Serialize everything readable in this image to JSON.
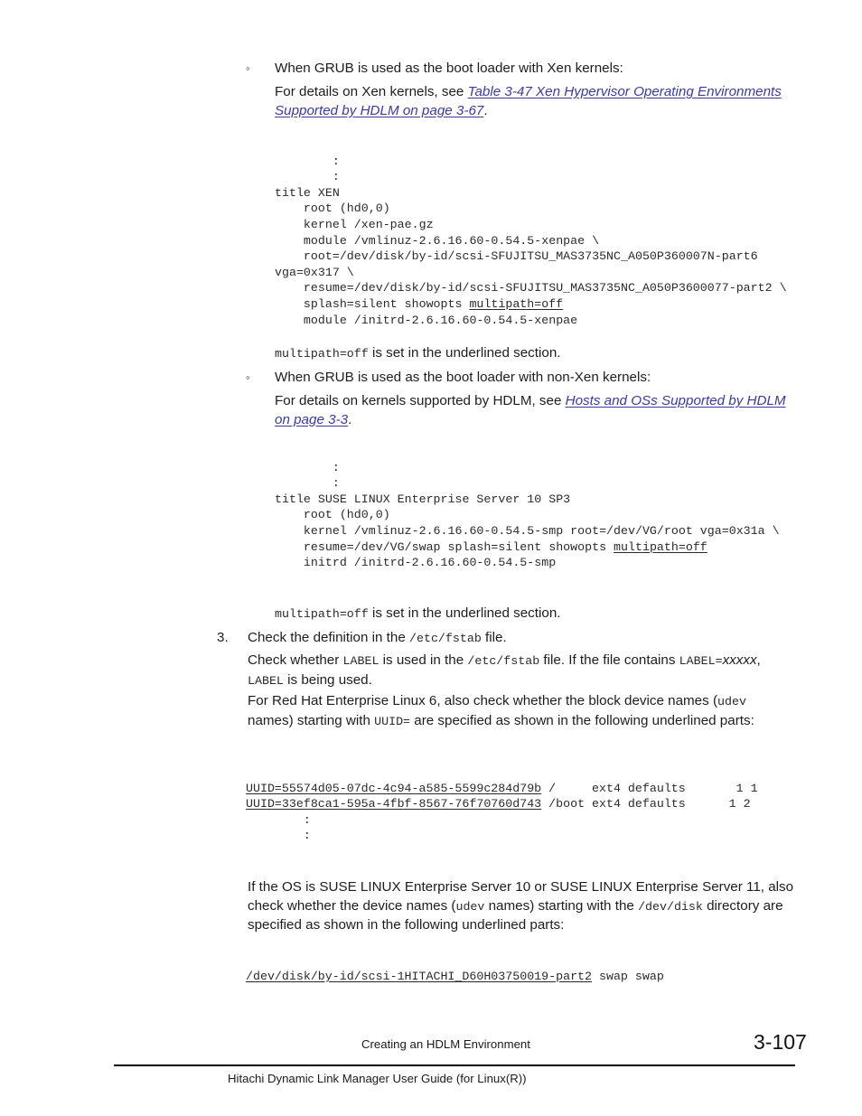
{
  "document": {
    "page_number": "3-107",
    "footer_section": "Creating an HDLM Environment",
    "footer_title": "Hitachi Dynamic Link Manager User Guide (for Linux(R))"
  },
  "colors": {
    "link": "#3b3b9e",
    "text": "#1d1d1d",
    "code": "#2a2a2a",
    "rule": "#000000"
  },
  "icons": {
    "bullet": "◦"
  },
  "content": {
    "bullet_xen": {
      "heading": "When GRUB is used as the boot loader with Xen kernels:",
      "lead_in": "For details on Xen kernels, see ",
      "link_text": "Table 3-47 Xen Hypervisor Operating Environments Supported by HDLM on page 3-67",
      "lead_out": ".",
      "code": ":\n        :\ntitle XEN\n    root (hd0,0)\n    kernel /xen-pae.gz\n    module /vmlinuz-2.6.16.60-0.54.5-xenpae \\\n    root=/dev/disk/by-id/scsi-SFUJITSU_MAS3735NC_A050P360007N-part6 vga=0x317 \\\n    resume=/dev/disk/by-id/scsi-SFUJITSU_MAS3735NC_A050P3600077-part2 \\\n    splash=silent showopts multipath=off\n    module /initrd-2.6.16.60-0.54.5-xenpae",
      "code_lines": [
        "        :",
        "        :",
        "title XEN",
        "    root (hd0,0)",
        "    kernel /xen-pae.gz",
        "    module /vmlinuz-2.6.16.60-0.54.5-xenpae \\",
        "    root=/dev/disk/by-id/scsi-SFUJITSU_MAS3735NC_A050P360007N-part6 vga=0x317 \\",
        "    resume=/dev/disk/by-id/scsi-SFUJITSU_MAS3735NC_A050P3600077-part2 \\",
        "    splash=silent showopts multipath=off",
        "    module /initrd-2.6.16.60-0.54.5-xenpae"
      ],
      "note_code": "multipath=off",
      "note_text": " is set in the underlined section."
    },
    "bullet_nonxen": {
      "heading": "When GRUB is used as the boot loader with non-Xen kernels:",
      "lead_in": "For details on kernels supported by HDLM, see ",
      "link_text": "Hosts and OSs Supported by HDLM on page 3-3",
      "lead_out": ".",
      "code_lines": [
        "        :",
        "        :",
        "title SUSE LINUX Enterprise Server 10 SP3",
        "    root (hd0,0)",
        "    kernel /vmlinuz-2.6.16.60-0.54.5-smp root=/dev/VG/root vga=0x31a \\",
        "    resume=/dev/VG/swap splash=silent showopts multipath=off",
        "    initrd /initrd-2.6.16.60-0.54.5-smp"
      ],
      "note_code": "multipath=off",
      "note_text": " is set in the underlined section."
    },
    "step3": {
      "number": "3.",
      "title_a": "Check the definition in the ",
      "title_code": "/etc/fstab",
      "title_b": " file.",
      "para1_a": "Check whether ",
      "para1_code1": "LABEL",
      "para1_b": " is used in the ",
      "para1_code2": "/etc/fstab",
      "para1_c": " file. If the file contains ",
      "para1_code3": "LABEL=",
      "para1_italic": "xxxxx",
      "para1_d": ", ",
      "para1_code4": "LABEL",
      "para1_e": " is being used.",
      "para2_a": "For Red Hat Enterprise Linux 6, also check whether the block device names (",
      "para2_code1": "udev",
      "para2_b": " names) starting with ",
      "para2_code2": "UUID=",
      "para2_c": " are specified as shown in the following underlined parts:",
      "fstab_uuid1": "UUID=55574d05-07dc-4c94-a585-5599c284d79b",
      "fstab_uuid1_rest": " /     ext4 defaults       1 1",
      "fstab_uuid2": "UUID=33ef8ca1-595a-4fbf-8567-76f70760d743",
      "fstab_uuid2_rest": " /boot ext4 defaults      1 2",
      "fstab_dots1": "        :",
      "fstab_dots2": "        :",
      "para3_a": "If the OS is SUSE LINUX Enterprise Server 10 or SUSE LINUX Enterprise Server 11, also check whether the device names (",
      "para3_code1": "udev",
      "para3_b": " names) starting with the ",
      "para3_code2": "/dev/disk",
      "para3_c": " directory are specified as shown in the following underlined parts:",
      "dev_line_underlined": "/dev/disk/by-id/scsi-1HITACHI_D60H03750019-part2",
      "dev_line_rest": " swap swap"
    }
  }
}
